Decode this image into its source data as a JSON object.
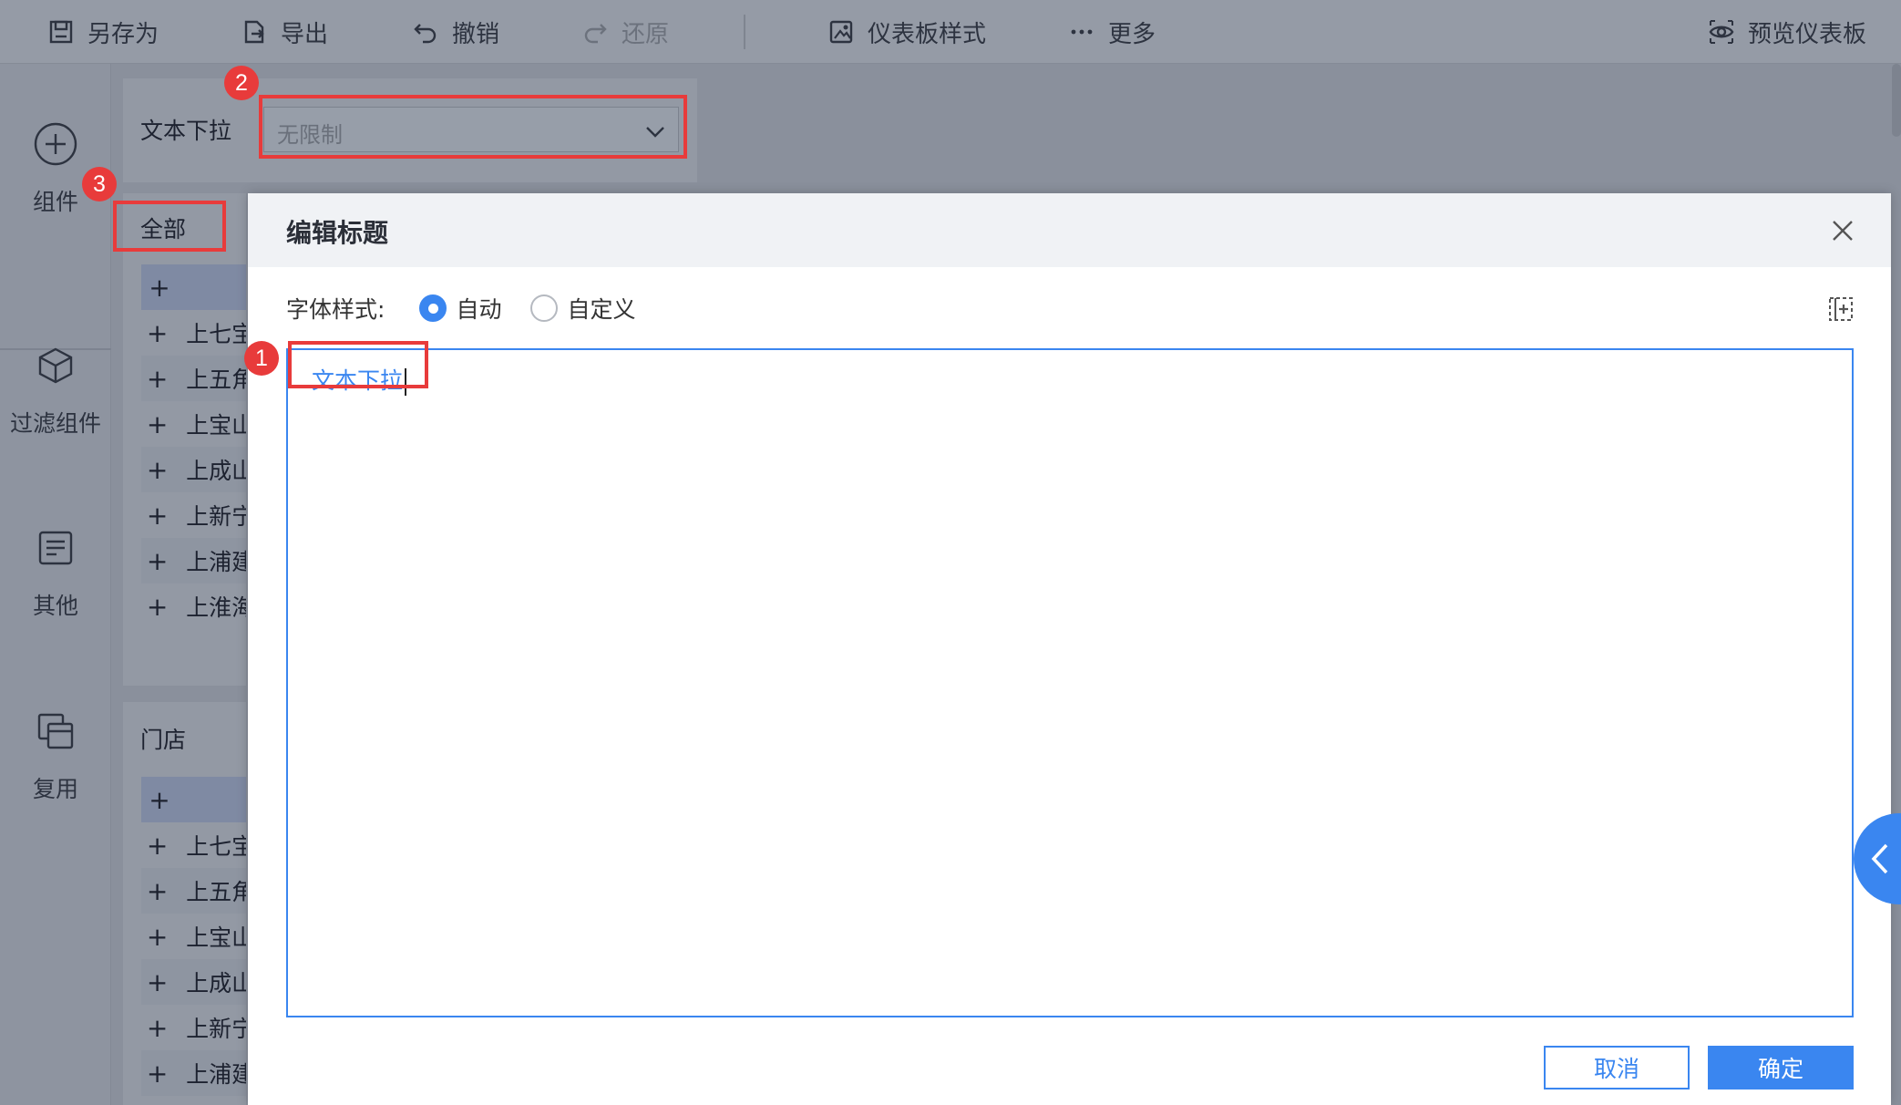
{
  "toolbar": {
    "save_as": "另存为",
    "export": "导出",
    "undo": "撤销",
    "redo": "还原",
    "dashboard_style": "仪表板样式",
    "more": "更多",
    "preview": "预览仪表板"
  },
  "rail": {
    "components": "组件",
    "filter_components": "过滤组件",
    "other": "其他",
    "reuse": "复用"
  },
  "filter": {
    "label": "文本下拉",
    "dropdown_value": "无限制"
  },
  "tree1": {
    "header": "全部",
    "rows": [
      "上七宝",
      "上五角",
      "上宝山",
      "上成山",
      "上新宁",
      "上浦建",
      "上淮海"
    ]
  },
  "tree2": {
    "header": "门店",
    "rows": [
      "上七宝",
      "上五角",
      "上宝山",
      "上成山",
      "上新宁",
      "上浦建"
    ]
  },
  "annotations": {
    "one": "1",
    "two": "2",
    "three": "3"
  },
  "modal": {
    "title": "编辑标题",
    "font_style_label": "字体样式:",
    "option_auto": "自动",
    "option_custom": "自定义",
    "selected_option": "自动",
    "editor_text": "文本下拉",
    "cancel": "取消",
    "confirm": "确定"
  },
  "colors": {
    "accent": "#3a86f0",
    "annotation": "#e83b3b"
  }
}
